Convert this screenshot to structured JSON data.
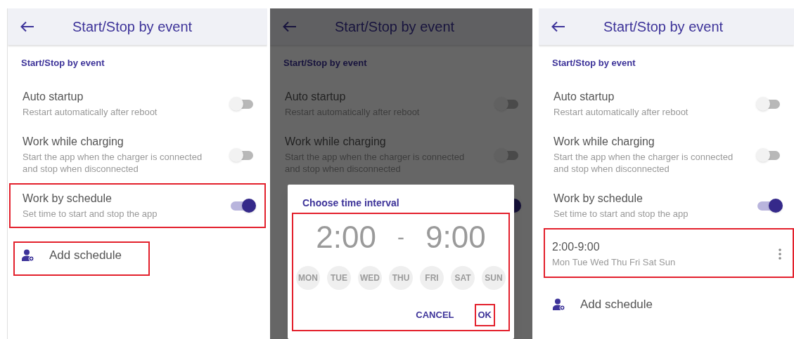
{
  "panels": [
    {
      "title": "Start/Stop by event",
      "section": "Start/Stop by event",
      "dimmed": false,
      "settings": [
        {
          "title": "Auto startup",
          "subtitle": "Restart automatically after reboot",
          "on": false,
          "highlighted": false
        },
        {
          "title": "Work while charging",
          "subtitle": "Start the app when the charger is connected and stop when disconnected",
          "on": false,
          "highlighted": false
        },
        {
          "title": "Work by schedule",
          "subtitle": "Set time to start and stop the app",
          "on": true,
          "highlighted": true
        }
      ],
      "add_schedule": {
        "label": "Add schedule",
        "highlighted": true
      }
    },
    {
      "title": "Start/Stop by event",
      "section": "Start/Stop by event",
      "dimmed": true,
      "settings": [
        {
          "title": "Auto startup",
          "subtitle": "Restart automatically after reboot",
          "on": false,
          "highlighted": false
        },
        {
          "title": "Work while charging",
          "subtitle": "Start the app when the charger is connected and stop when disconnected",
          "on": false,
          "highlighted": false
        },
        {
          "on": true,
          "highlighted": false
        }
      ],
      "dialog": {
        "title": "Choose time interval",
        "start": "2:00",
        "separator": "-",
        "end": "9:00",
        "highlighted": true,
        "days": [
          {
            "label": "MON",
            "selected": false
          },
          {
            "label": "TUE",
            "selected": false
          },
          {
            "label": "WED",
            "selected": false
          },
          {
            "label": "THU",
            "selected": false
          },
          {
            "label": "FRI",
            "selected": false
          },
          {
            "label": "SAT",
            "selected": false
          },
          {
            "label": "SUN",
            "selected": false
          }
        ],
        "buttons": [
          {
            "label": "CANCEL",
            "highlighted": false
          },
          {
            "label": "OK",
            "highlighted": true
          }
        ]
      }
    },
    {
      "title": "Start/Stop by event",
      "section": "Start/Stop by event",
      "dimmed": false,
      "settings": [
        {
          "title": "Auto startup",
          "subtitle": "Restart automatically after reboot",
          "on": false,
          "highlighted": false
        },
        {
          "title": "Work while charging",
          "subtitle": "Start the app when the charger is connected and stop when disconnected",
          "on": false,
          "highlighted": false
        },
        {
          "title": "Work by schedule",
          "subtitle": "Set time to start and stop the app",
          "on": true,
          "highlighted": false
        }
      ],
      "schedules": [
        {
          "time": "2:00-9:00",
          "days": "Mon Tue Wed Thu Fri Sat Sun",
          "highlighted": true
        }
      ],
      "add_schedule": {
        "label": "Add schedule",
        "highlighted": false
      }
    }
  ]
}
